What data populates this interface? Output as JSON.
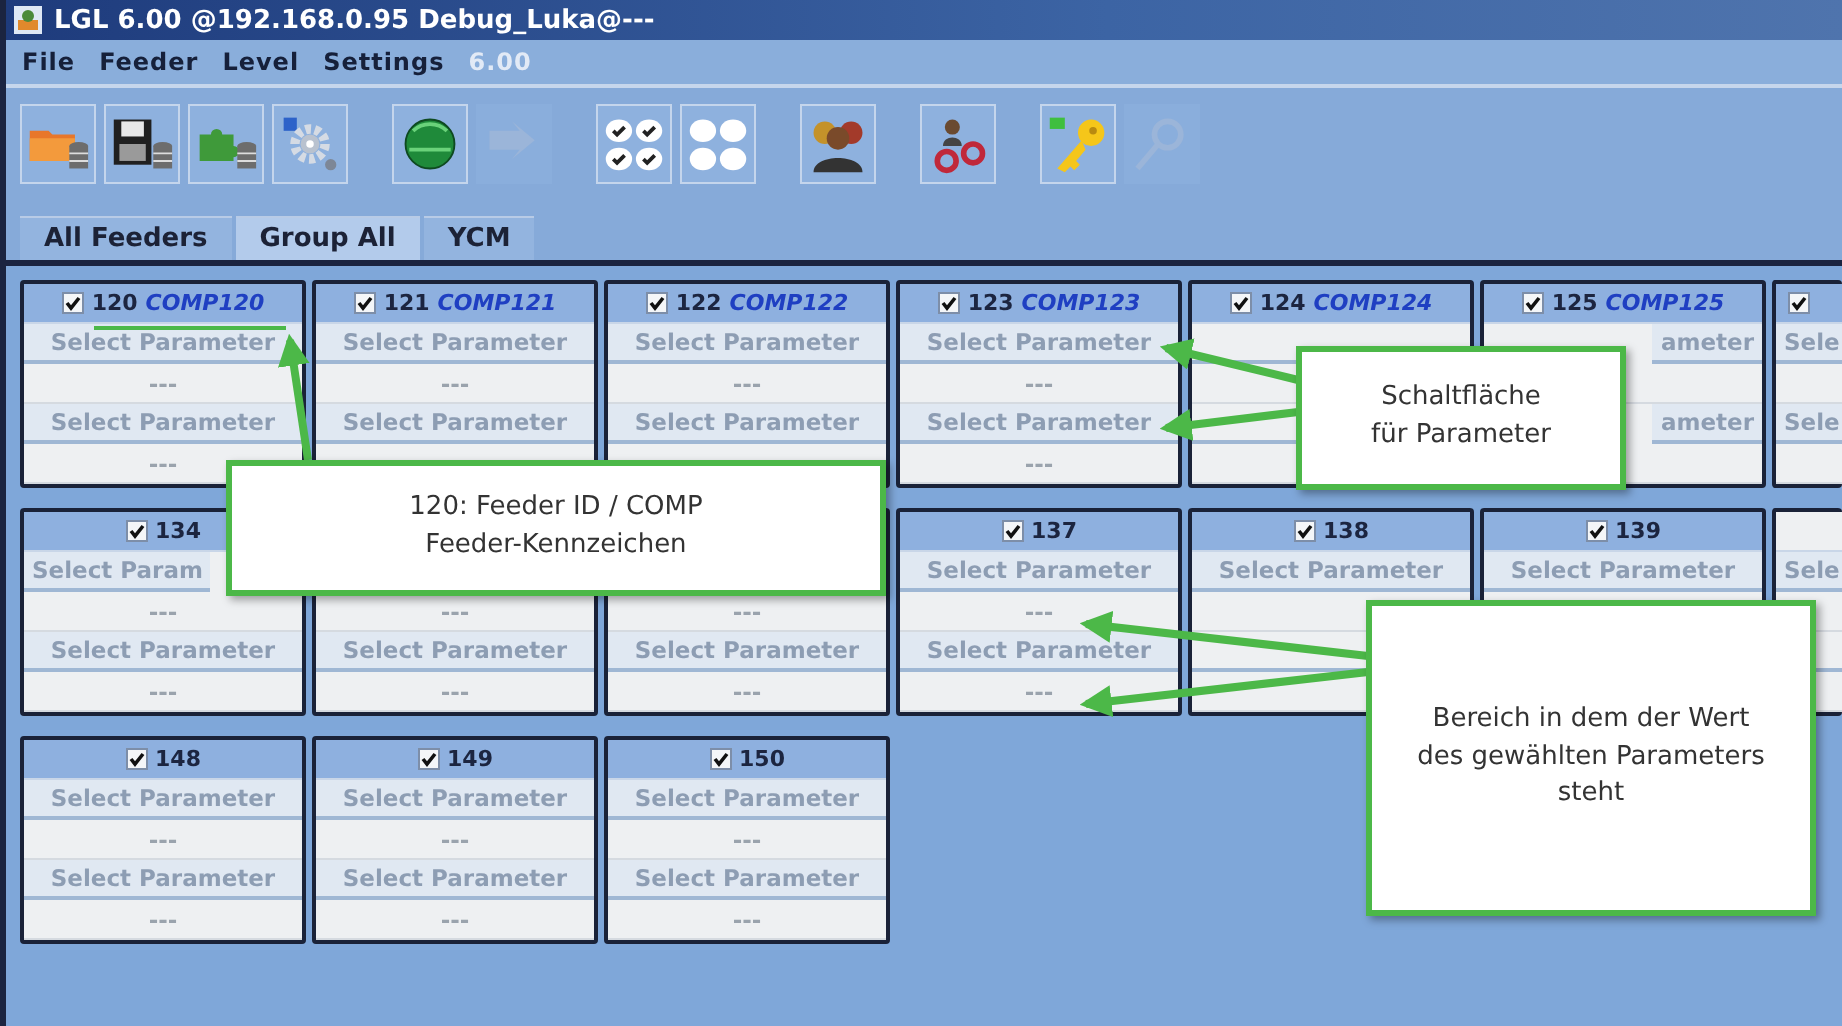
{
  "window": {
    "title": "LGL 6.00 @192.168.0.95 Debug_Luka@---"
  },
  "menu": [
    {
      "label": "File",
      "disabled": false
    },
    {
      "label": "Feeder",
      "disabled": false
    },
    {
      "label": "Level",
      "disabled": false
    },
    {
      "label": "Settings",
      "disabled": false
    },
    {
      "label": "6.00",
      "disabled": true
    }
  ],
  "toolbar": {
    "groups": [
      [
        {
          "kind": "folder-db",
          "disabled": false
        },
        {
          "kind": "save-db",
          "disabled": false
        },
        {
          "kind": "puzzle-db",
          "disabled": false
        },
        {
          "kind": "gear",
          "disabled": false
        }
      ],
      [
        {
          "kind": "globe",
          "disabled": false
        },
        {
          "kind": "arrow",
          "disabled": true
        }
      ],
      [
        {
          "kind": "checks",
          "disabled": false
        },
        {
          "kind": "circles",
          "disabled": false
        }
      ],
      [
        {
          "kind": "people",
          "disabled": false
        }
      ],
      [
        {
          "kind": "link",
          "disabled": false
        }
      ],
      [
        {
          "kind": "key",
          "disabled": false
        },
        {
          "kind": "tool",
          "disabled": true
        }
      ]
    ]
  },
  "tabs": [
    {
      "label": "All Feeders",
      "selected": false
    },
    {
      "label": "Group All",
      "selected": true
    },
    {
      "label": "YCM",
      "selected": false
    }
  ],
  "feeder_rows": [
    {
      "cards": [
        {
          "header": {
            "checked": true,
            "id": "120",
            "comp": "COMP120"
          },
          "slots": [
            {
              "kind": "button",
              "text": "Select Parameter"
            },
            {
              "kind": "value",
              "text": "---"
            },
            {
              "kind": "button",
              "text": "Select Parameter"
            },
            {
              "kind": "value",
              "text": "---"
            }
          ]
        },
        {
          "header": {
            "checked": true,
            "id": "121",
            "comp": "COMP121"
          },
          "slots": [
            {
              "kind": "button",
              "text": "Select Parameter"
            },
            {
              "kind": "value",
              "text": "---"
            },
            {
              "kind": "button",
              "text": "Select Parameter"
            },
            {
              "kind": "value"
            }
          ]
        },
        {
          "header": {
            "checked": true,
            "id": "122",
            "comp": "COMP122"
          },
          "slots": [
            {
              "kind": "button",
              "text": "Select Parameter"
            },
            {
              "kind": "value",
              "text": "---"
            },
            {
              "kind": "button",
              "text": "Select Parameter"
            },
            {
              "kind": "value"
            }
          ]
        },
        {
          "header": {
            "checked": true,
            "id": "123",
            "comp": "COMP123"
          },
          "slots": [
            {
              "kind": "button",
              "text": "Select Parameter"
            },
            {
              "kind": "value",
              "text": "---"
            },
            {
              "kind": "button",
              "text": "Select Parameter"
            },
            {
              "kind": "value",
              "text": "---"
            }
          ]
        },
        {
          "header": {
            "checked": true,
            "id": "124",
            "comp": "COMP124"
          },
          "slots": [
            {
              "kind": "button"
            },
            {
              "kind": "value"
            },
            {
              "kind": "button"
            },
            {
              "kind": "value"
            }
          ]
        },
        {
          "header": {
            "checked": true,
            "id": "125",
            "comp": "COMP125"
          },
          "slots": [
            {
              "kind": "button_tail",
              "text": "ameter"
            },
            {
              "kind": "value"
            },
            {
              "kind": "button_tail",
              "text": "ameter"
            },
            {
              "kind": "value"
            }
          ]
        },
        {
          "header": {
            "checked": true
          },
          "slots": [
            {
              "kind": "button_head",
              "text": "Sele"
            },
            {
              "kind": "value"
            },
            {
              "kind": "button_head",
              "text": "Sele"
            },
            {
              "kind": "value"
            }
          ]
        }
      ]
    },
    {
      "cards": [
        {
          "header": {
            "checked": true,
            "id": "134"
          },
          "slots": [
            {
              "kind": "button_head",
              "text": "Select Param"
            },
            {
              "kind": "value",
              "text": "---"
            },
            {
              "kind": "button",
              "text": "Select Parameter"
            },
            {
              "kind": "value",
              "text": "---"
            }
          ]
        },
        {
          "slots": [
            {
              "kind": "button"
            },
            {
              "kind": "value",
              "text": "---"
            },
            {
              "kind": "button",
              "text": "Select Parameter"
            },
            {
              "kind": "value",
              "text": "---"
            }
          ]
        },
        {
          "slots": [
            {
              "kind": "button"
            },
            {
              "kind": "value",
              "text": "---"
            },
            {
              "kind": "button",
              "text": "Select Parameter"
            },
            {
              "kind": "value",
              "text": "---"
            }
          ]
        },
        {
          "header": {
            "checked": true,
            "id": "137"
          },
          "slots": [
            {
              "kind": "button",
              "text": "Select Parameter"
            },
            {
              "kind": "value",
              "text": "---"
            },
            {
              "kind": "button",
              "text": "Select Parameter"
            },
            {
              "kind": "value",
              "text": "---"
            }
          ]
        },
        {
          "header": {
            "checked": true,
            "id": "138"
          },
          "slots": [
            {
              "kind": "button",
              "text": "Select Parameter"
            },
            {
              "kind": "value"
            },
            {
              "kind": "button"
            },
            {
              "kind": "value"
            }
          ]
        },
        {
          "header": {
            "checked": true,
            "id": "139"
          },
          "slots": [
            {
              "kind": "button",
              "text": "Select Parameter"
            },
            {
              "kind": "value"
            },
            {
              "kind": "button"
            },
            {
              "kind": "value"
            }
          ]
        },
        {
          "slots": [
            {
              "kind": "button_head",
              "text": "Sele"
            },
            {
              "kind": "value"
            },
            {
              "kind": "button"
            },
            {
              "kind": "value"
            }
          ]
        }
      ]
    },
    {
      "cards": [
        {
          "header": {
            "checked": true,
            "id": "148"
          },
          "slots": [
            {
              "kind": "button",
              "text": "Select Parameter"
            },
            {
              "kind": "value",
              "text": "---"
            },
            {
              "kind": "button",
              "text": "Select Parameter"
            },
            {
              "kind": "value",
              "text": "---"
            }
          ]
        },
        {
          "header": {
            "checked": true,
            "id": "149"
          },
          "slots": [
            {
              "kind": "button",
              "text": "Select Parameter"
            },
            {
              "kind": "value",
              "text": "---"
            },
            {
              "kind": "button",
              "text": "Select Parameter"
            },
            {
              "kind": "value",
              "text": "---"
            }
          ]
        },
        {
          "header": {
            "checked": true,
            "id": "150"
          },
          "slots": [
            {
              "kind": "button",
              "text": "Select Parameter"
            },
            {
              "kind": "value",
              "text": "---"
            },
            {
              "kind": "button",
              "text": "Select Parameter"
            },
            {
              "kind": "value",
              "text": "---"
            }
          ]
        }
      ]
    }
  ],
  "callouts": [
    {
      "text": "120: Feeder ID / COMP\nFeeder-Kennzeichen"
    },
    {
      "text": "Schaltfläche\nfür Parameter"
    },
    {
      "text": "Bereich in dem der Wert\ndes gewählten Parameters\nsteht"
    }
  ]
}
